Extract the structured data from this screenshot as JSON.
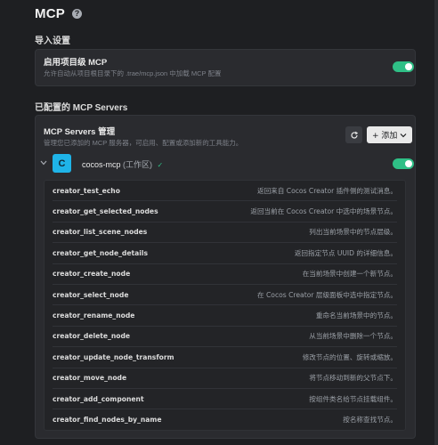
{
  "header": {
    "title": "MCP"
  },
  "import_section": {
    "title": "导入设置",
    "setting_title": "启用项目级 MCP",
    "setting_desc": "允许自动从项目根目录下的 .trae/mcp.json 中加载 MCP 配置",
    "enabled": true
  },
  "servers_section": {
    "title": "已配置的 MCP Servers",
    "manage_title": "MCP Servers 管理",
    "manage_desc": "管理您已添加的 MCP 服务器，可启用、配置或添加新的工具能力。",
    "add_label": "+ 添加",
    "server": {
      "avatar_letter": "C",
      "name": "cocos-mcp",
      "tag": "(工作区)",
      "check": "✓",
      "enabled": true
    }
  },
  "tools": [
    {
      "name": "creator_test_echo",
      "desc": "返回来自 Cocos Creator 插件侧的测试消息。"
    },
    {
      "name": "creator_get_selected_nodes",
      "desc": "返回当前在 Cocos Creator 中选中的场景节点。"
    },
    {
      "name": "creator_list_scene_nodes",
      "desc": "列出当前场景中的节点层级。"
    },
    {
      "name": "creator_get_node_details",
      "desc": "返回指定节点 UUID 的详细信息。"
    },
    {
      "name": "creator_create_node",
      "desc": "在当前场景中创建一个新节点。"
    },
    {
      "name": "creator_select_node",
      "desc": "在 Cocos Creator 层级面板中选中指定节点。"
    },
    {
      "name": "creator_rename_node",
      "desc": "重命名当前场景中的节点。"
    },
    {
      "name": "creator_delete_node",
      "desc": "从当前场景中删除一个节点。"
    },
    {
      "name": "creator_update_node_transform",
      "desc": "修改节点的位置、旋转或缩放。"
    },
    {
      "name": "creator_move_node",
      "desc": "将节点移动到新的父节点下。"
    },
    {
      "name": "creator_add_component",
      "desc": "按组件类名给节点挂载组件。"
    },
    {
      "name": "creator_find_nodes_by_name",
      "desc": "按名称查找节点。"
    }
  ],
  "icons": {
    "help": "help-icon",
    "refresh": "refresh-icon",
    "chevron_add": "chevron-down-icon",
    "expand": "chevron-down-icon"
  },
  "colors": {
    "accent_green": "#2fbf86",
    "server_avatar": "#1fb4e8"
  }
}
